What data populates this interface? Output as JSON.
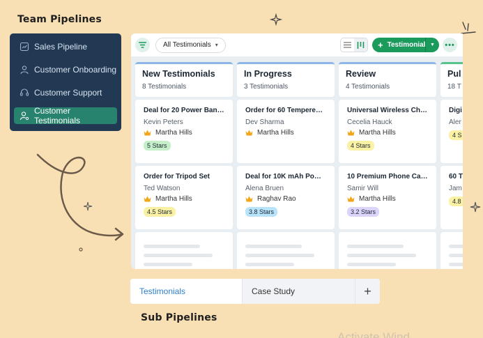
{
  "team_title": "Team Pipelines",
  "sub_title": "Sub Pipelines",
  "sidebar": {
    "items": [
      {
        "label": "Sales Pipeline",
        "icon": "chart-icon"
      },
      {
        "label": "Customer Onboarding",
        "icon": "user-icon"
      },
      {
        "label": "Customer Support",
        "icon": "headset-icon"
      },
      {
        "label": "Customer Testimonials",
        "icon": "user-gear-icon",
        "active": true
      }
    ]
  },
  "toolbar": {
    "filter_select": "All Testimonials",
    "add_label": "Testimonial"
  },
  "columns": [
    {
      "name": "New Testimonials",
      "count": "8 Testimonials",
      "cards": [
        {
          "title": "Deal for 20 Power Banks",
          "person": "Kevin Peters",
          "owner": "Martha Hills",
          "badge": "5 Stars",
          "badge_color": "#c5efc9"
        },
        {
          "title": "Order for Tripod Set",
          "person": "Ted Watson",
          "owner": "Martha Hills",
          "badge": "4.5 Stars",
          "badge_color": "#fbf1a5"
        }
      ]
    },
    {
      "name": "In Progress",
      "count": "3 Testimonials",
      "cards": [
        {
          "title": "Order for 60 Tempered …",
          "person": "Dev Sharma",
          "owner": "Martha Hills",
          "badge": "",
          "badge_color": ""
        },
        {
          "title": "Deal for 10K mAh Powe…",
          "person": "Alena Bruen",
          "owner": "Raghav Rao",
          "badge": "3.8 Stars",
          "badge_color": "#b7e3fb"
        }
      ]
    },
    {
      "name": "Review",
      "count": "4 Testimonials",
      "cards": [
        {
          "title": "Universal Wireless Char…",
          "person": "Cecelia Hauck",
          "owner": "Martha Hills",
          "badge": "4 Stars",
          "badge_color": "#fbf1a5"
        },
        {
          "title": "10 Premium Phone Cases",
          "person": "Samir Will",
          "owner": "Martha Hills",
          "badge": "3.2 Stars",
          "badge_color": "#ddd4fb"
        }
      ]
    },
    {
      "name": "Pul",
      "count": "18 T",
      "cards": [
        {
          "title": "Digi",
          "person": "Aler",
          "owner": "",
          "badge": "4 S",
          "badge_color": "#fbf1a5"
        },
        {
          "title": "60 T",
          "person": "Jam",
          "owner": "",
          "badge": "4.8",
          "badge_color": "#fbf1a5"
        }
      ]
    }
  ],
  "tabs": {
    "active": "Testimonials",
    "other": "Case Study",
    "add": "+"
  },
  "watermark": "Activate Wind"
}
